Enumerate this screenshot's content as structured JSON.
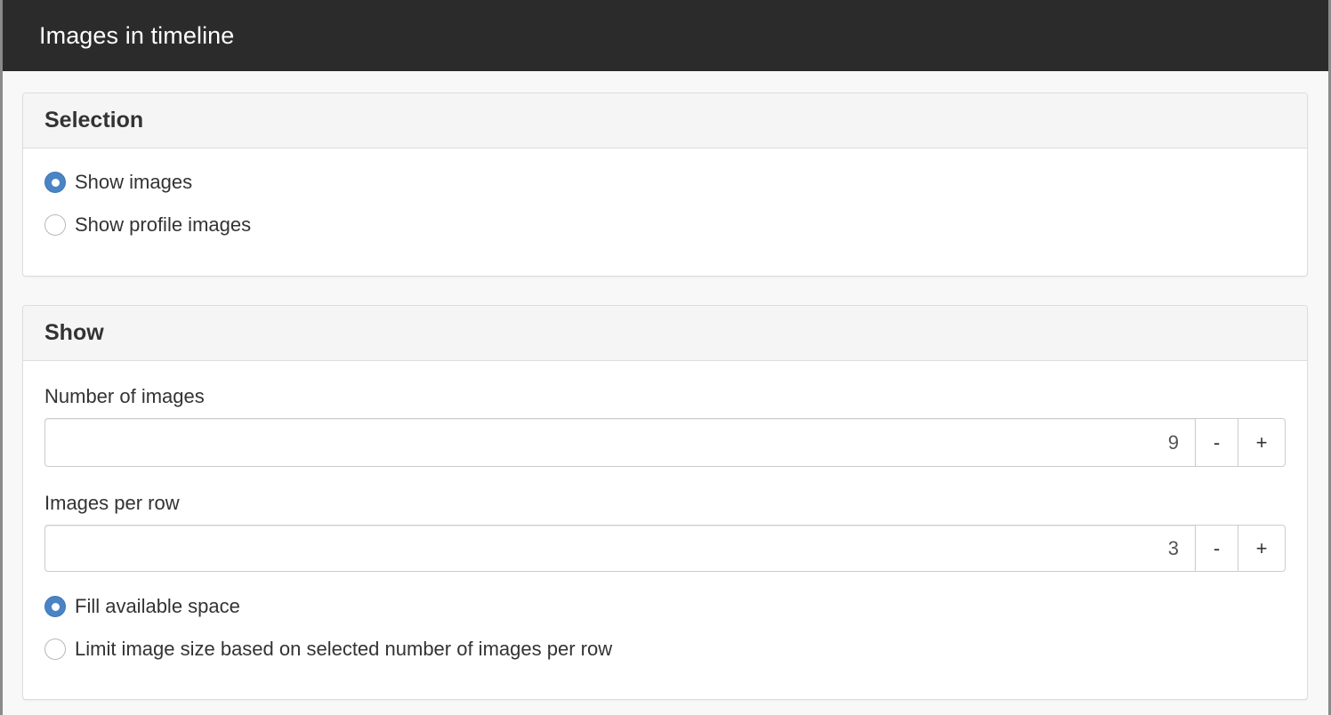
{
  "window": {
    "title": "Images in timeline"
  },
  "selection": {
    "heading": "Selection",
    "options": [
      {
        "label": "Show images",
        "checked": true
      },
      {
        "label": "Show profile images",
        "checked": false
      }
    ]
  },
  "show": {
    "heading": "Show",
    "number_of_images": {
      "label": "Number of images",
      "value": "9",
      "minus_label": "-",
      "plus_label": "+"
    },
    "images_per_row": {
      "label": "Images per row",
      "value": "3",
      "minus_label": "-",
      "plus_label": "+"
    },
    "size_options": [
      {
        "label": "Fill available space",
        "checked": true
      },
      {
        "label": "Limit image size based on selected number of images per row",
        "checked": false
      }
    ]
  },
  "colors": {
    "titlebar": "#2b2b2b",
    "radio_checked": "#4a84c5",
    "panel_heading_bg": "#f5f5f5"
  }
}
